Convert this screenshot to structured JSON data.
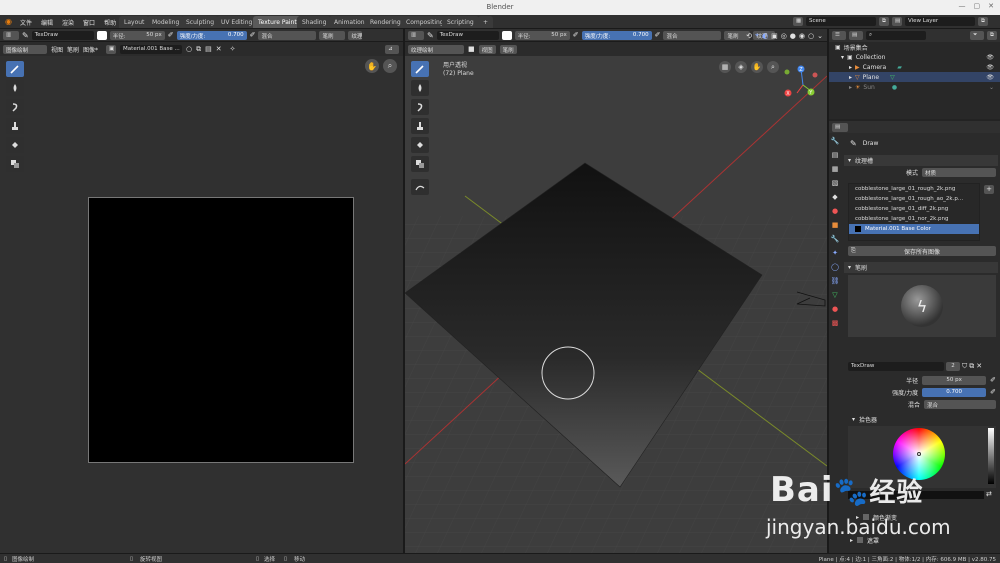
{
  "window": {
    "title": "Blender",
    "minimize": "—",
    "maximize": "▢",
    "close": "✕"
  },
  "menu": [
    "文件",
    "编辑",
    "渲染",
    "窗口",
    "帮助"
  ],
  "workspaces": [
    "Layout",
    "Modeling",
    "Sculpting",
    "UV Editing",
    "Texture Paint",
    "Shading",
    "Animation",
    "Rendering",
    "Compositing",
    "Scripting",
    "+"
  ],
  "active_workspace": "Texture Paint",
  "scene": {
    "scene_label": "Scene",
    "view_layer": "View Layer"
  },
  "left_editor": {
    "brush_name": "TexDraw",
    "radius_label": "半径:",
    "radius_value": "50 px",
    "strength_label": "强度/力度:",
    "strength_value": "0.700",
    "blend": "混合",
    "brush_menu": "笔刷",
    "texture_menu": "纹理",
    "mode": "图像绘制",
    "view_menu": "视图",
    "brush_menu2": "笔刷",
    "image_menu": "图像*",
    "image_name": "Material.001 Base ..."
  },
  "viewport": {
    "brush_name": "TexDraw",
    "radius_label": "半径:",
    "radius_value": "50 px",
    "strength_label": "强度/力度:",
    "strength_value": "0.700",
    "blend": "混合",
    "brush_menu": "笔刷",
    "texture_menu": "纹理",
    "mode": "纹理绘制",
    "view_menu": "视图",
    "brush_menu2": "笔刷",
    "overlay_title": "用户透视",
    "overlay_object": "(72) Plane",
    "axis_x": "X",
    "axis_y": "Y",
    "axis_z": "Z"
  },
  "outliner": {
    "header": "场景集合",
    "collection": "Collection",
    "items": [
      "Camera",
      "Plane",
      "Sun"
    ]
  },
  "properties": {
    "brush_title": "Draw",
    "texture_slots_label": "纹理槽",
    "mode_label": "模式",
    "mode_value": "材质",
    "images": [
      "cobblestone_large_01_rough_2k.png",
      "cobblestone_large_01_rough_ao_2k.p...",
      "cobblestone_large_01_diff_2k.png",
      "cobblestone_large_01_nor_2k.png",
      "Material.001 Base Color"
    ],
    "save_all": "保存所有图像",
    "brush_panel": "笔刷",
    "brush_name": "TexDraw",
    "brush_users": "2",
    "radius_label": "半径",
    "radius_value": "50 px",
    "strength_label": "强度/力度",
    "strength_value": "0.700",
    "blend_label": "混合",
    "blend_value": "混合",
    "color_picker": "拾色器",
    "gradient": "颜色渐变",
    "falloff": "遮罩"
  },
  "status": {
    "left1": "图像绘制",
    "left2": "旋转视图",
    "mid1": "选择",
    "mid2": "移动",
    "right": "Plane | 点:4 | 边:1 | 三角面:2 | 物体:1/2 | 内存: 606.9 MB | v2.80.75"
  },
  "watermark": {
    "brand": "Bai",
    "brand2": "经验",
    "url": "jingyan.baidu.com"
  },
  "colors": {
    "accent": "#4772b3",
    "bg": "#232323",
    "header": "#303030"
  }
}
